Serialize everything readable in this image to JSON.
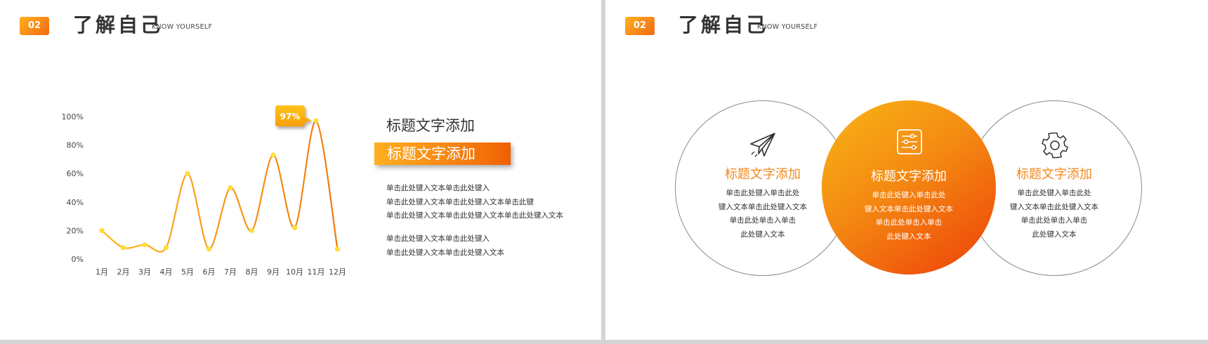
{
  "brand": {
    "accent": "#f58a14",
    "accent_dark": "#ef5a0a",
    "accent_light": "#ffb81c"
  },
  "slides": [
    {
      "header": {
        "badge": "02",
        "title": "了解自己",
        "subtitle": "KNOW YOURSELF"
      },
      "headline": "标题文字添加",
      "headline_highlight": "标题文字添加",
      "paragraph1": [
        "单击此处键入文本单击此处键入",
        "单击此处键入文本单击此处键入文本单击此键",
        "单击此处键入文本单击此处键入文本单击此处键入文本"
      ],
      "paragraph2": [
        "单击此处键入文本单击此处键入",
        "单击此处键入文本单击此处键入文本"
      ]
    },
    {
      "header": {
        "badge": "02",
        "title": "了解自己",
        "subtitle": "KNOW YOURSELF"
      },
      "circles": [
        {
          "icon": "paper-plane-icon",
          "title": "标题文字添加",
          "body": [
            "单击此处键入单击此处",
            "键入文本单击此处键入文本",
            "单击此处单击入单击",
            "此处键入文本"
          ]
        },
        {
          "icon": "sliders-icon",
          "title": "标题文字添加",
          "body": [
            "单击此处键入单击此处",
            "键入文本单击此处键入文本",
            "单击此处单击入单击",
            "此处键入文本"
          ]
        },
        {
          "icon": "gear-icon",
          "title": "标题文字添加",
          "body": [
            "单击此处键入单击此处",
            "键入文本单击此处键入文本",
            "单击此处单击入单击",
            "此处键入文本"
          ]
        }
      ]
    }
  ],
  "chart_data": {
    "type": "line",
    "smooth": true,
    "categories": [
      "1月",
      "2月",
      "3月",
      "4月",
      "5月",
      "6月",
      "7月",
      "8月",
      "9月",
      "10月",
      "11月",
      "12月"
    ],
    "series": [
      {
        "values": [
          20,
          8,
          10,
          8,
          60,
          7,
          50,
          20,
          73,
          22,
          97,
          7
        ]
      }
    ],
    "yticks": [
      "0%",
      "20%",
      "40%",
      "60%",
      "80%",
      "100%"
    ],
    "ylim": [
      0,
      100
    ],
    "grid": false,
    "legend": "none",
    "annotation": {
      "text": "97%",
      "category": "11月",
      "value": 97
    },
    "colors": {
      "line": "#f5920f",
      "marker": "#ffe03a",
      "label_fill": "#f9b00c"
    }
  }
}
